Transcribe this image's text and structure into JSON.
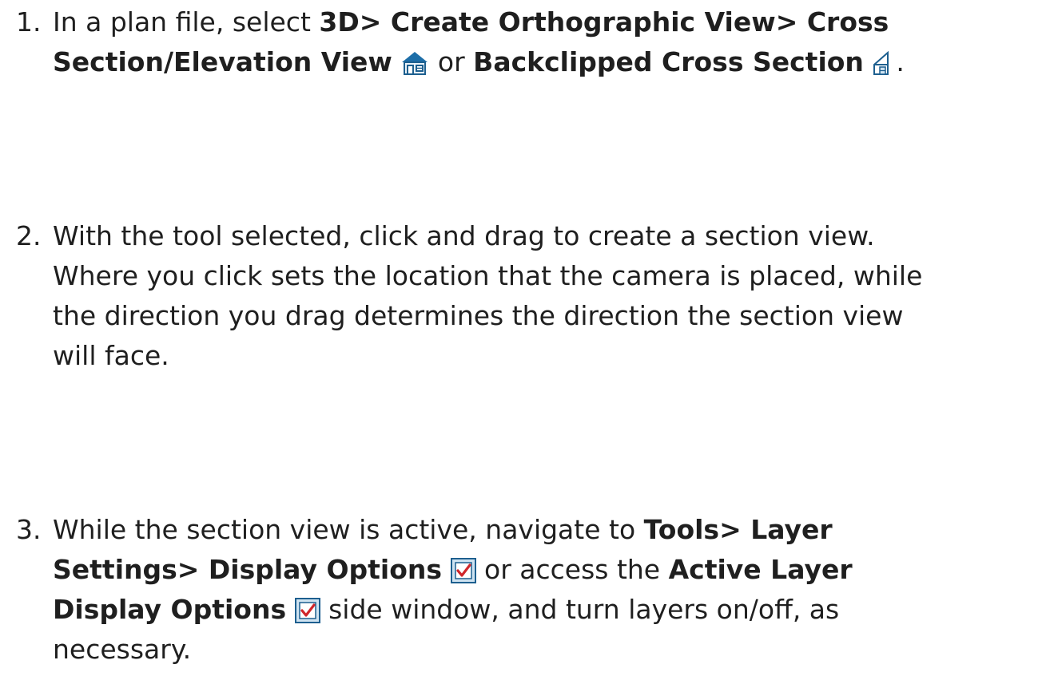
{
  "steps": [
    {
      "number": "1.",
      "line1": {
        "t1": "In a plan file, select ",
        "b1": "3D> Create Orthographic View> Cross"
      },
      "line2": {
        "b1": "Section/Elevation View",
        "icon1": "house-elevation-icon",
        "t1": " or ",
        "b2": "Backclipped Cross Section",
        "icon2": "backclipped-section-icon",
        "t2": "."
      }
    },
    {
      "number": "2.",
      "lines": [
        "With the tool selected, click and drag to create a section view.",
        "Where you click sets the location that the camera is placed, while",
        "the direction you drag determines the direction the section view",
        "will face."
      ]
    },
    {
      "number": "3.",
      "line1": {
        "t1": "While the section view is active, navigate to ",
        "b1": "Tools> Layer"
      },
      "line2": {
        "b1": "Settings> Display Options",
        "icon1": "display-options-checkbox-icon",
        "t1": " or access the ",
        "b2": "Active Layer"
      },
      "line3": {
        "b1": "Display Options",
        "icon1": "display-options-checkbox-icon",
        "t1": " side window, and turn layers on/off, as"
      },
      "line4": "necessary."
    }
  ],
  "colors": {
    "text": "#1f1f1f",
    "icon_blue": "#1d5f8f",
    "icon_light_blue": "#cfe3f1",
    "check_red": "#d0262b"
  }
}
